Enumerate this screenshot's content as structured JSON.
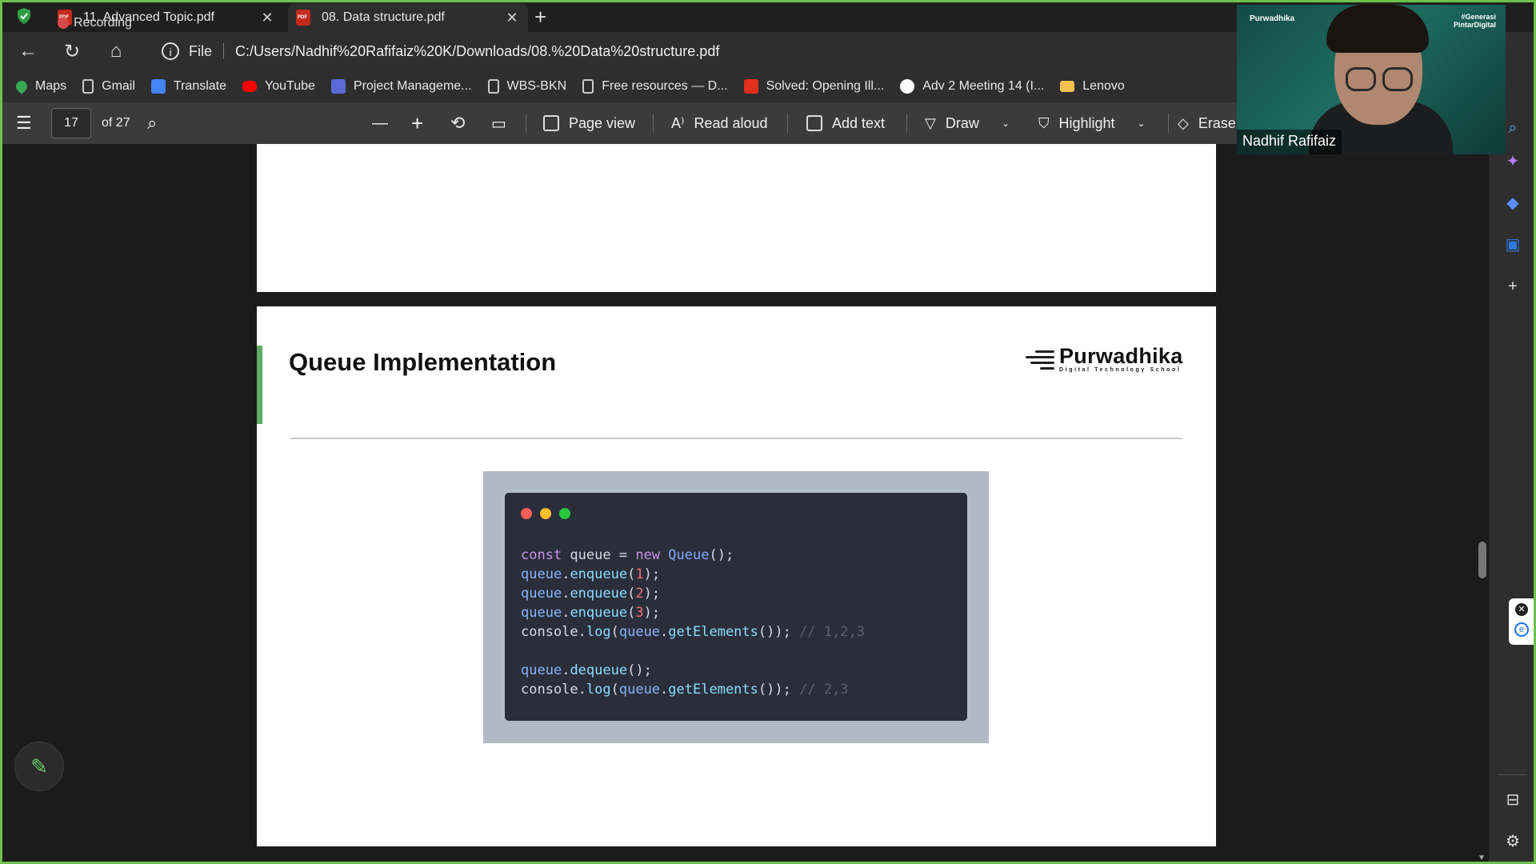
{
  "tabs": [
    {
      "title": "11. Advanced Topic.pdf",
      "close": "✕"
    },
    {
      "title": "08. Data structure.pdf",
      "close": "✕"
    }
  ],
  "recording_label": "Recording",
  "new_tab": "+",
  "address": {
    "scheme_label": "File",
    "url": "C:/Users/Nadhif%20Rafifaiz%20K/Downloads/08.%20Data%20structure.pdf"
  },
  "bookmarks": [
    {
      "label": "Maps",
      "icon": "maps-icon",
      "color": "#34a853"
    },
    {
      "label": "Gmail",
      "icon": "page-icon",
      "color": "#888888"
    },
    {
      "label": "Translate",
      "icon": "translate-icon",
      "color": "#4285f4"
    },
    {
      "label": "YouTube",
      "icon": "youtube-icon",
      "color": "#ff0000"
    },
    {
      "label": "Project Manageme...",
      "icon": "project-icon",
      "color": "#5b6bd6"
    },
    {
      "label": "WBS-BKN",
      "icon": "page-icon",
      "color": "#888888"
    },
    {
      "label": "Free resources — D...",
      "icon": "page-icon",
      "color": "#888888"
    },
    {
      "label": "Solved: Opening Ill...",
      "icon": "adobe-icon",
      "color": "#e0301e"
    },
    {
      "label": "Adv 2 Meeting 14 (I...",
      "icon": "github-icon",
      "color": "#ffffff"
    },
    {
      "label": "Lenovo",
      "icon": "folder-icon",
      "color": "#f2c14e"
    }
  ],
  "pdf_toolbar": {
    "page_current": "17",
    "page_total": "of 27",
    "zoom_out": "—",
    "zoom_in": "+",
    "page_view": "Page view",
    "read_aloud": "Read aloud",
    "add_text": "Add text",
    "draw": "Draw",
    "highlight": "Highlight",
    "erase": "Erase"
  },
  "slide": {
    "title": "Queue Implementation",
    "logo_name": "Purwadhika",
    "logo_tagline": "Digital Technology School"
  },
  "code_lines": [
    "const queue = new Queue();",
    "queue.enqueue(1);",
    "queue.enqueue(2);",
    "queue.enqueue(3);",
    "console.log(queue.getElements()); // 1,2,3",
    "",
    "queue.dequeue();",
    "console.log(queue.getElements()); // 2,3"
  ],
  "code_window_dots": [
    "#ff5f56",
    "#ffbd2e",
    "#27c93f"
  ],
  "webcam": {
    "brand": "Purwadhika",
    "tag_line1": "#Generasi",
    "tag_line2": "PintarDigital",
    "participant_name": "Nadhif Rafifaiz"
  },
  "colors": {
    "accent_green": "#5daa61",
    "frame_border": "#6cc14a"
  }
}
